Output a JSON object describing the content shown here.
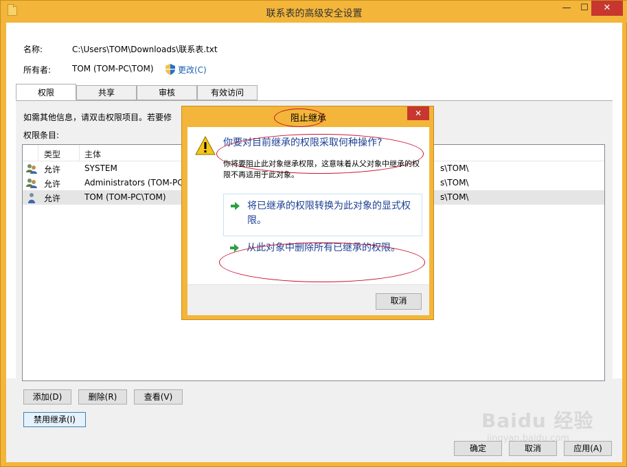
{
  "window": {
    "title": "联系表的高级安全设置",
    "controls": {
      "minimize": "—",
      "maximize": "☐",
      "close": "✕"
    }
  },
  "info": {
    "name_label": "名称:",
    "name_value": "C:\\Users\\TOM\\Downloads\\联系表.txt",
    "owner_label": "所有者:",
    "owner_value": "TOM (TOM-PC\\TOM)",
    "change_link": "更改(C)"
  },
  "tabs": [
    {
      "label": "权限",
      "active": true
    },
    {
      "label": "共享",
      "active": false
    },
    {
      "label": "审核",
      "active": false
    },
    {
      "label": "有效访问",
      "active": false
    }
  ],
  "panel": {
    "hint": "如需其他信息，请双击权限项目。若要修",
    "entries_label": "权限条目:"
  },
  "list": {
    "columns": [
      "类型",
      "主体"
    ],
    "rows": [
      {
        "type": "允许",
        "principal": "SYSTEM",
        "tail": "s\\TOM\\",
        "icon": "group-icon",
        "selected": false
      },
      {
        "type": "允许",
        "principal": "Administrators (TOM-PC",
        "tail": "s\\TOM\\",
        "icon": "group-icon",
        "selected": false
      },
      {
        "type": "允许",
        "principal": "TOM (TOM-PC\\TOM)",
        "tail": "s\\TOM\\",
        "icon": "user-icon",
        "selected": true
      }
    ]
  },
  "buttons": {
    "add": "添加(D)",
    "remove": "删除(R)",
    "view": "查看(V)",
    "disable_inheritance": "禁用继承(I)",
    "ok": "确定",
    "cancel": "取消",
    "apply": "应用(A)"
  },
  "dialog": {
    "title": "阻止继承",
    "close": "✕",
    "heading": "你要对目前继承的权限采取何种操作?",
    "description": "你将要阻止此对象继承权限，这意味着从父对象中继承的权限不再适用于此对象。",
    "option1": "将已继承的权限转换为此对象的显式权限。",
    "option2": "从此对象中删除所有已继承的权限。",
    "cancel": "取消"
  },
  "watermark": {
    "main": "Baidu 经验",
    "sub": "jingyan.baidu.com"
  },
  "colors": {
    "frame": "#f3b53a",
    "close_red": "#c7372f",
    "link_blue": "#1c3f94",
    "annotation_red": "#c8102e"
  }
}
